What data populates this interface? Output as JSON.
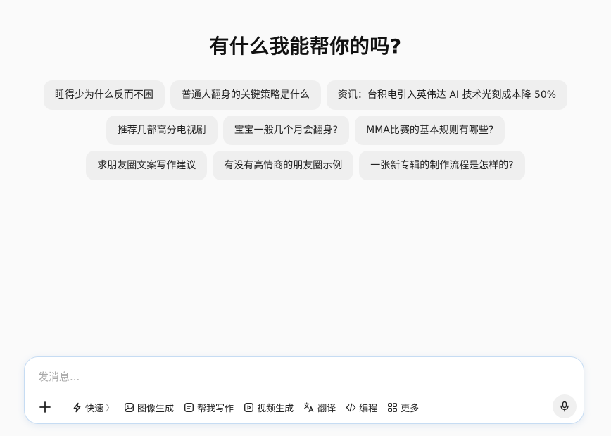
{
  "heading": "有什么我能帮你的吗?",
  "suggestions": {
    "rows": [
      [
        "睡得少为什么反而不困",
        "普通人翻身的关键策略是什么",
        "资讯：台积电引入英伟达 AI 技术光刻成本降 50%"
      ],
      [
        "推荐几部高分电视剧",
        "宝宝一般几个月会翻身?",
        "MMA比赛的基本规则有哪些?"
      ],
      [
        "求朋友圈文案写作建议",
        "有没有高情商的朋友圈示例",
        "一张新专辑的制作流程是怎样的?"
      ]
    ]
  },
  "composer": {
    "placeholder": "发消息...",
    "value": "",
    "tools": {
      "quick": "快速",
      "image": "图像生成",
      "write": "帮我写作",
      "video": "视频生成",
      "translate": "翻译",
      "code": "编程",
      "more": "更多"
    },
    "chevron": "〉",
    "icons": {
      "plus": "plus-icon",
      "quick": "lightning-icon",
      "image": "image-icon",
      "write": "document-icon",
      "video": "video-icon",
      "translate": "translate-icon",
      "code": "code-icon",
      "more": "grid-icon",
      "mic": "microphone-icon"
    }
  },
  "colors": {
    "background": "#fafafa",
    "chip": "#efefef",
    "composer_border": "#c6dcf3"
  }
}
